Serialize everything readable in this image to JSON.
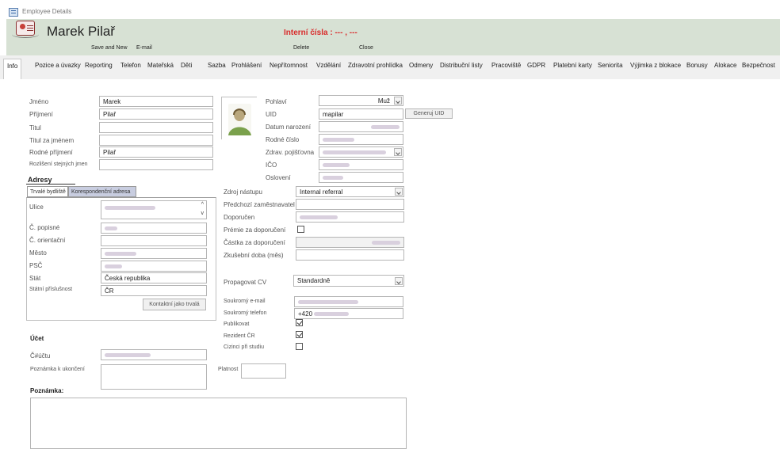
{
  "window": {
    "title": "Employee Details"
  },
  "header": {
    "name": "Marek Pilař",
    "interni": "Interní čísla : --- , ---",
    "save_new": "Save and New",
    "email": "E-mail",
    "delete": "Delete",
    "close": "Close"
  },
  "tabs": [
    "Info",
    "Pozice a úvazky",
    "Reporting",
    "Telefon",
    "Mateřská",
    "Děti",
    "Sazba",
    "Prohlášení",
    "Nepřítomnost",
    "Vzdělání",
    "Zdravotní prohlídka",
    "Odmeny",
    "Distribuční listy",
    "Pracoviště",
    "GDPR",
    "Platební karty",
    "Seniorita",
    "Výjimka z blokace",
    "Bonusy",
    "Alokace",
    "Bezpečnost"
  ],
  "personal": {
    "jmeno_label": "Jméno",
    "jmeno": "Marek",
    "prijmeni_label": "Příjmení",
    "prijmeni": "Pilař",
    "titul_label": "Titul",
    "titul_za_label": "Titul za jménem",
    "rodne_prijmeni_label": "Rodné příjmení",
    "rodne_prijmeni": "Pilař",
    "rozliseni_label": "Rozlišení stejných jmen"
  },
  "adresy": {
    "heading": "Adresy",
    "tab_trvale": "Trvalé bydliště",
    "tab_koresp": "Korespondenční adresa",
    "ulice_label": "Ulice",
    "cislo_pop_label": "Č. popisné",
    "cislo_or_label": "Č. orientační",
    "mesto_label": "Město",
    "psc_label": "PSČ",
    "stat_label": "Stát",
    "stat": "Česká republika",
    "prislusnost_label": "Státní příslušnost",
    "prislusnost": "ČR",
    "kontaktni_btn": "Kontaktní jako trvalá"
  },
  "ucet": {
    "heading": "Účet",
    "cislo_label": "Č#účtu",
    "poznamka_ukonceni_label": "Poznámka k ukončení",
    "platnost_label": "Platnost"
  },
  "poznamka_label": "Poznámka:",
  "right": {
    "pohlavi_label": "Pohlaví",
    "pohlavi": "Muž",
    "uid_label": "UID",
    "uid": "mapilar",
    "generuj_btn": "Generuj UID",
    "datum_label": "Datum narození",
    "rodne_cislo_label": "Rodné číslo",
    "pojistovna_label": "Zdrav. pojišťovna",
    "ico_label": "IČO",
    "osloveni_label": "Oslovení",
    "zdroj_label": "Zdroj nástupu",
    "zdroj": "Internal referral",
    "predchozi_label": "Předchozí zaměstnavatel",
    "doporucen_label": "Doporučen",
    "premie_label": "Prémie za doporučení",
    "castka_label": "Částka za doporučení",
    "zkusebni_label": "Zkušební doba (měs)",
    "propagovat_label": "Propagovat CV",
    "propagovat": "Standardně",
    "email_label": "Soukromý e-mail",
    "telefon_label": "Soukromý telefon",
    "telefon_prefix": "+420",
    "publikovat_label": "Publikovat",
    "rezident_label": "Rezident ČR",
    "cizinci_label": "Cizinci při studiu"
  }
}
